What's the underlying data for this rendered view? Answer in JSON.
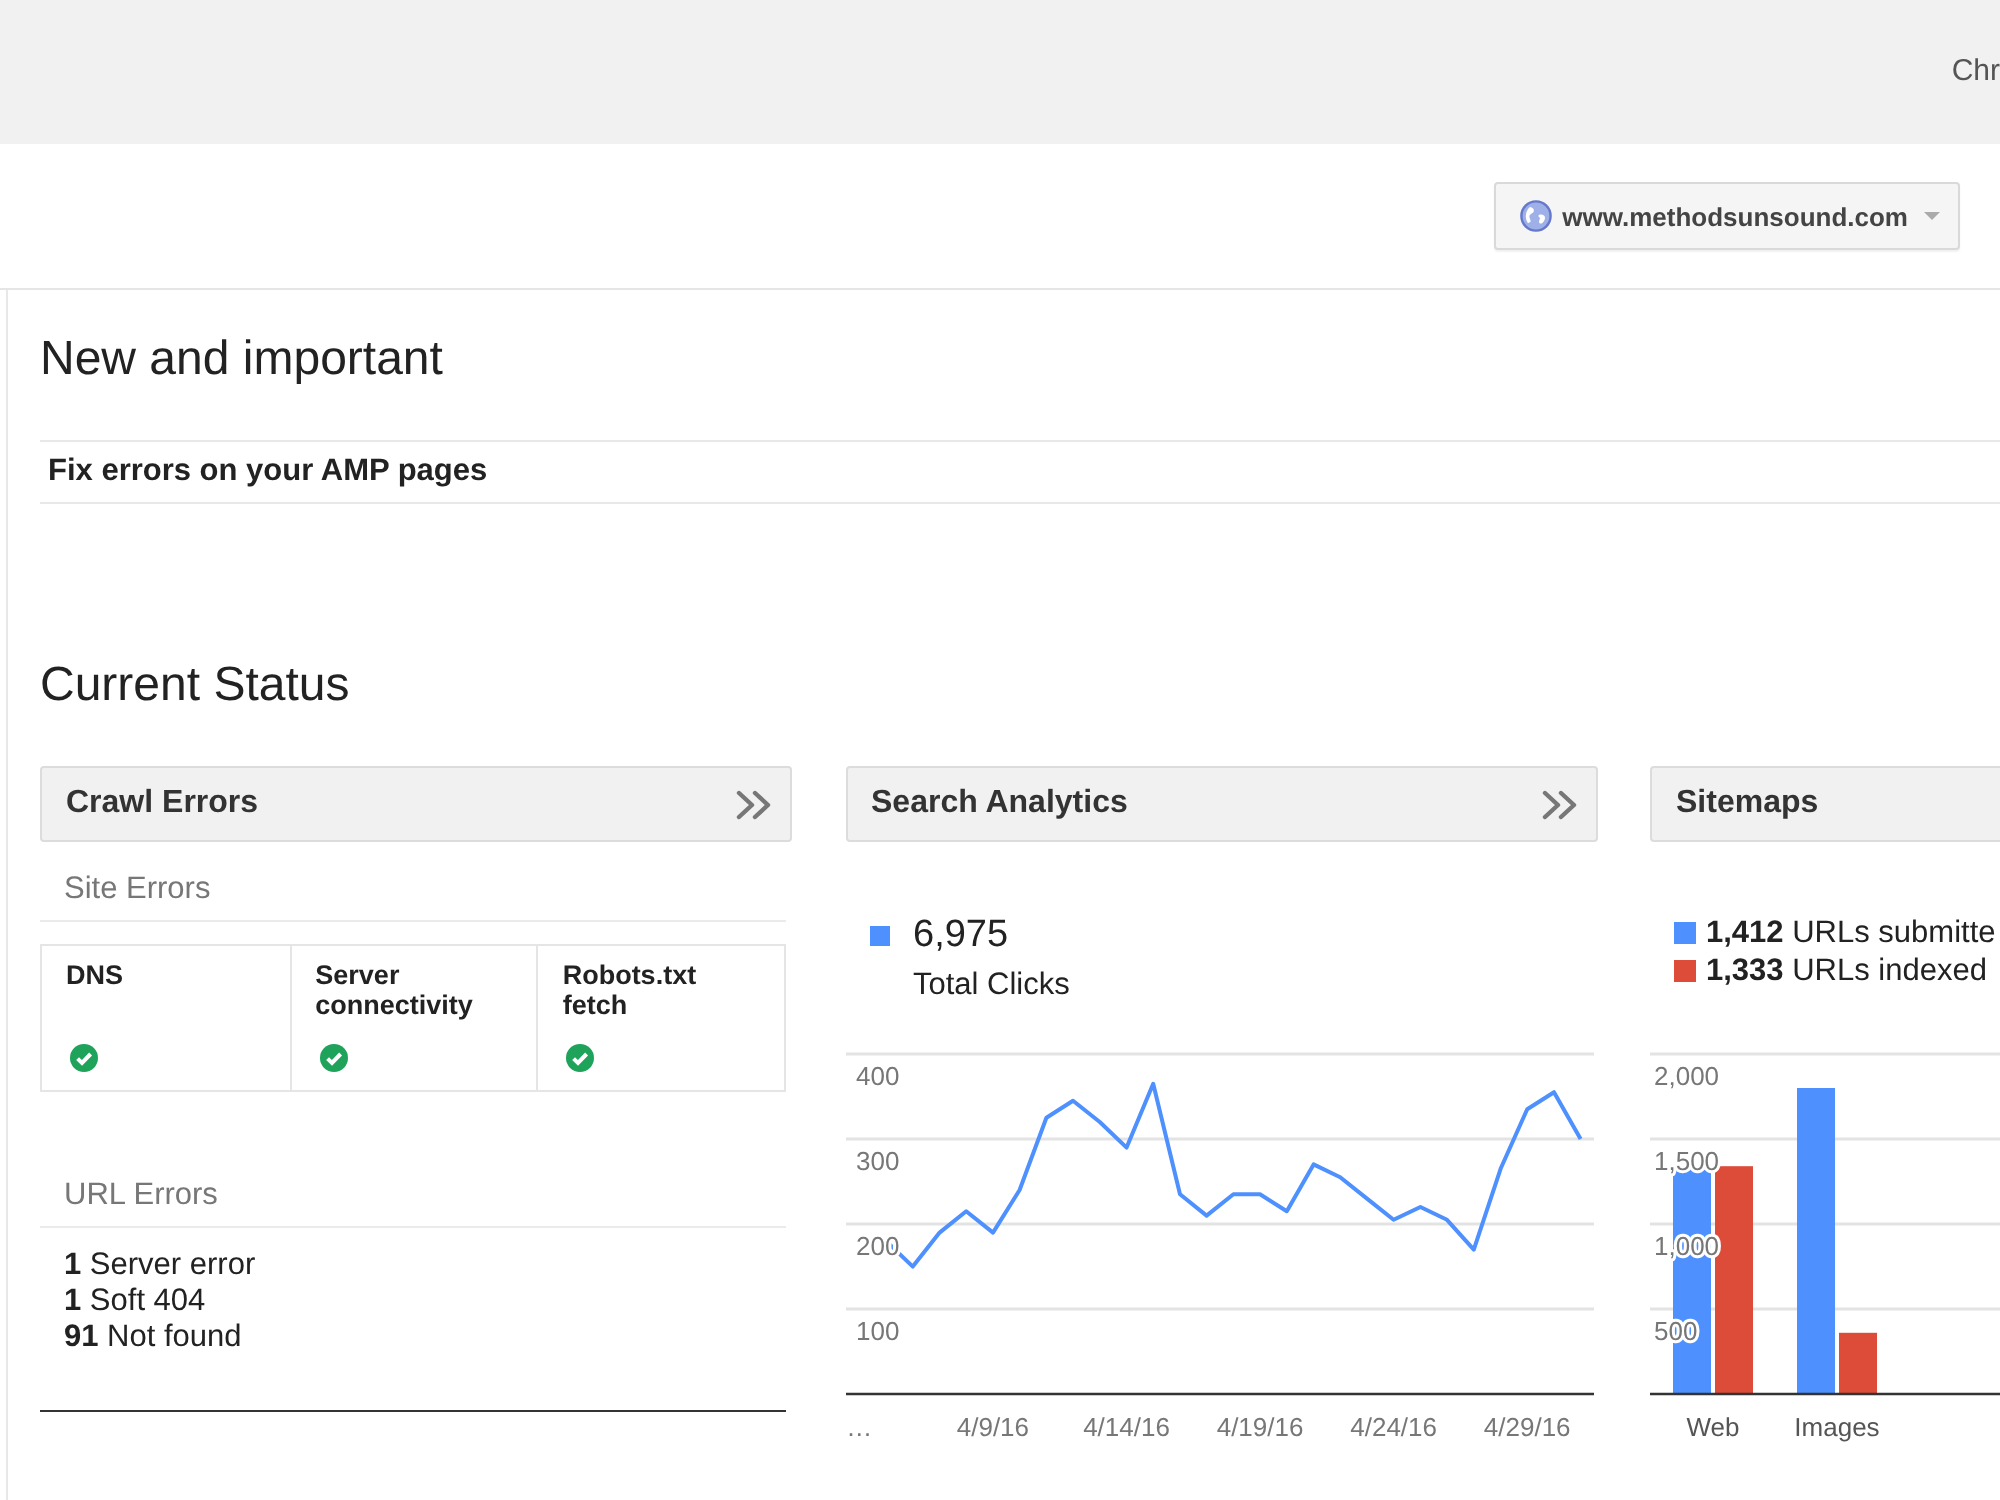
{
  "header": {
    "account": "Chr"
  },
  "site_selector": {
    "value": "www.methodsunsound.com"
  },
  "new_and_important": {
    "title": "New and important",
    "messages": [
      {
        "text": "Fix errors on your AMP pages"
      }
    ]
  },
  "current_status": {
    "title": "Current Status",
    "cards": [
      {
        "kind": "crawl_errors",
        "title": "Crawl Errors",
        "expandable": true,
        "site_errors": {
          "title": "Site Errors",
          "checks": [
            {
              "label": "DNS",
              "ok": true
            },
            {
              "label": "Server connectivity",
              "ok": true
            },
            {
              "label": "Robots.txt fetch",
              "ok": true
            }
          ]
        },
        "url_errors": {
          "title": "URL Errors",
          "items": [
            "**1** Server error",
            "**1** Soft 404",
            "**91** Not found"
          ]
        }
      },
      {
        "kind": "search_analytics",
        "title": "Search Analytics",
        "expandable": true,
        "legend": [
          {
            "value": "6,975",
            "label": "Total Clicks",
            "color": "#4d90fe"
          }
        ],
        "chart_data": {
          "type": "line",
          "categories": [
            "…",
            null,
            null,
            null,
            null,
            "4/9/16",
            null,
            null,
            null,
            null,
            "4/14/16",
            null,
            null,
            null,
            null,
            "4/19/16",
            null,
            null,
            null,
            null,
            "4/24/16",
            null,
            null,
            null,
            null,
            "4/29/16",
            null,
            null
          ],
          "series": [
            {
              "color": "#4d90fe",
              "values": [
                null,
                180,
                150,
                190,
                215,
                190,
                240,
                325,
                345,
                320,
                290,
                365,
                235,
                210,
                235,
                235,
                215,
                270,
                255,
                230,
                205,
                220,
                205,
                170,
                265,
                335,
                355,
                300
              ]
            }
          ],
          "ylim": [
            0,
            400
          ],
          "yticks": [
            100,
            200,
            300,
            400
          ],
          "grid": true
        }
      },
      {
        "kind": "sitemaps",
        "title": "Sitemaps",
        "expandable": false,
        "legend": [
          {
            "text": "**1,412** URLs submitte",
            "color": "#4d90fe"
          },
          {
            "text": "**1,333** URLs indexed",
            "color": "#dd4b39"
          }
        ],
        "chart_data": {
          "type": "bar",
          "categories": [
            "Web",
            "Images"
          ],
          "series": [
            {
              "color": "#4d90fe",
              "values": [
                1320,
                1800
              ]
            },
            {
              "color": "#dd4b39",
              "values": [
                1340,
                360
              ]
            }
          ],
          "ylim": [
            0,
            2000
          ],
          "yticks": [
            {
              "value": 500,
              "label": "500"
            },
            {
              "value": 1000,
              "label": "1,000"
            },
            {
              "value": 1500,
              "label": "1,500"
            },
            {
              "value": 2000,
              "label": "2,000"
            }
          ],
          "grid": true
        }
      }
    ]
  }
}
